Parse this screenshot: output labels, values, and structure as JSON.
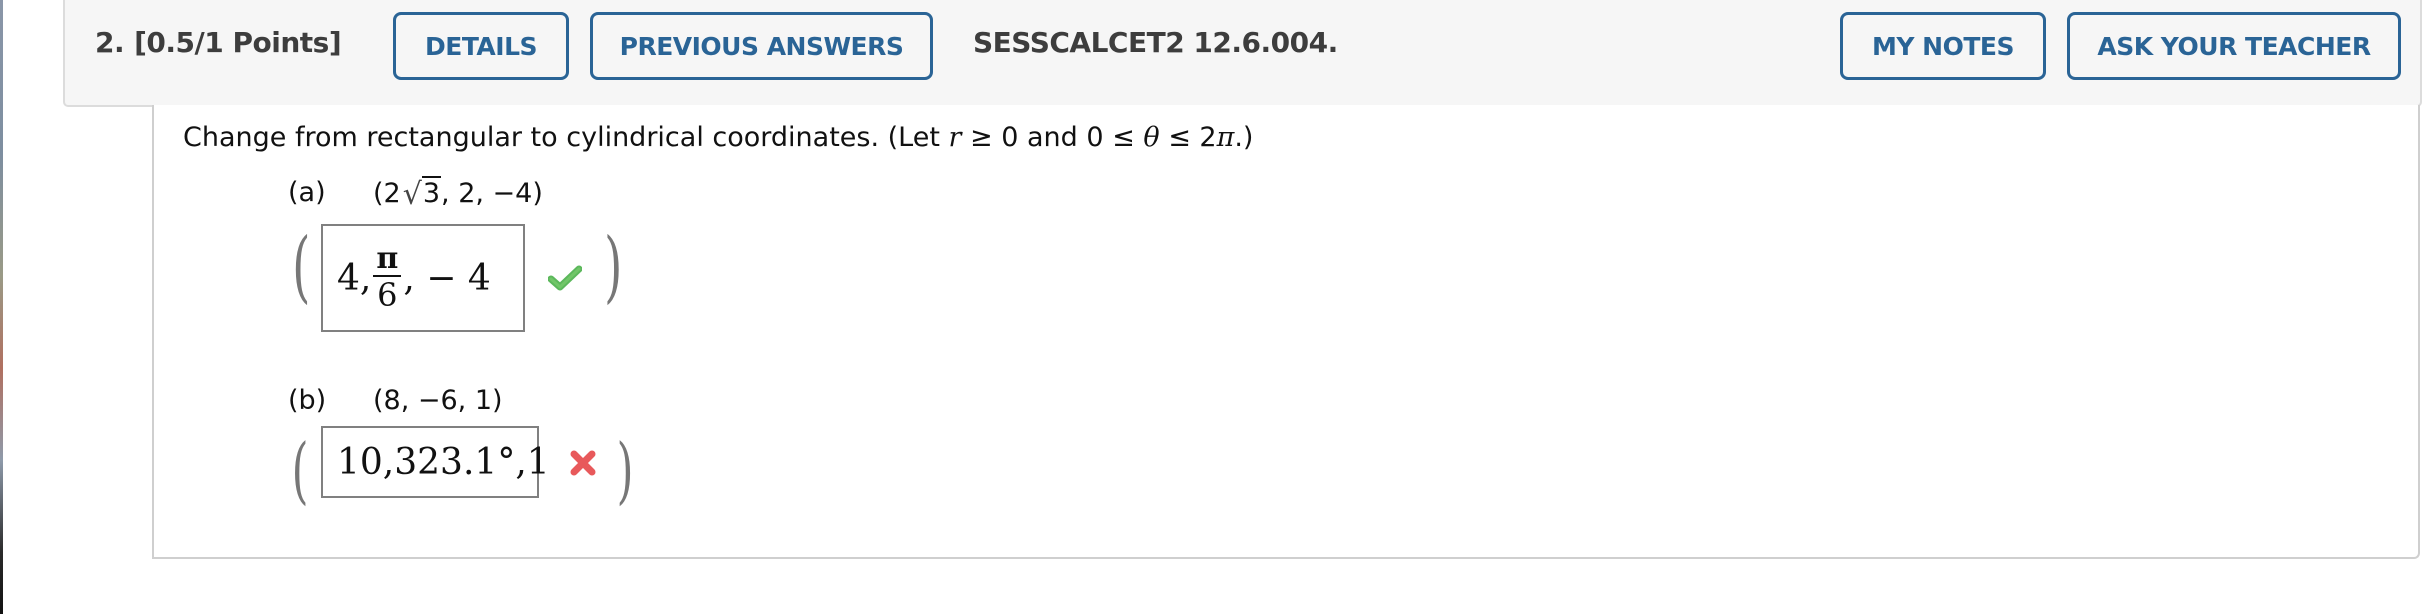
{
  "header": {
    "question_number": "2.",
    "points": "[0.5/1 Points]",
    "buttons": {
      "details": "DETAILS",
      "previous_answers": "PREVIOUS ANSWERS",
      "my_notes": "MY NOTES",
      "ask_teacher": "ASK YOUR TEACHER"
    },
    "question_code": "SESSCALCET2 12.6.004."
  },
  "question": {
    "prompt_prefix": "Change from rectangular to cylindrical coordinates. (Let ",
    "prompt_r": "r",
    "prompt_mid": " ≥ 0 and 0 ≤ ",
    "prompt_theta": "θ",
    "prompt_mid2": " ≤ 2",
    "prompt_pi": "π",
    "prompt_suffix": ".)",
    "parts": [
      {
        "label": "(a)",
        "point_prefix": "(2",
        "point_radicand": "3",
        "point_suffix": ", 2, −4)",
        "paren_open": "(",
        "paren_close": ")",
        "answer": {
          "first": "4,",
          "frac_num": "π",
          "frac_den": "6",
          "rest": ", − 4"
        },
        "status": "correct",
        "status_icon": "checkmark-icon"
      },
      {
        "label": "(b)",
        "point": "(8, −6, 1)",
        "paren_open": "(",
        "paren_close": ")",
        "answer": "10,323.1°,1",
        "status": "incorrect",
        "status_icon": "cross-icon"
      }
    ]
  },
  "colors": {
    "button_accent": "#2a6496",
    "header_bg": "#f6f6f6",
    "correct": "#5cb85c",
    "incorrect": "#e8595b",
    "text_dark": "#3d3d3d"
  }
}
